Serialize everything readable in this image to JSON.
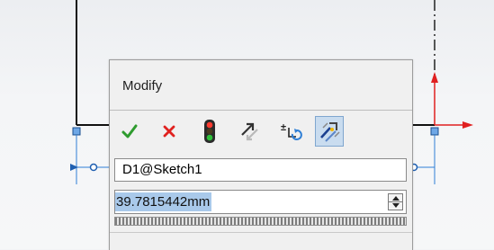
{
  "dialog": {
    "title": "Modify",
    "toolbar": [
      {
        "name": "ok-checkmark-icon",
        "tooltip": "OK"
      },
      {
        "name": "cancel-x-icon",
        "tooltip": "Cancel"
      },
      {
        "name": "rebuild-traffic-light-icon",
        "tooltip": "Rebuild"
      },
      {
        "name": "reverse-dimension-icon",
        "tooltip": "Reverse dimension"
      },
      {
        "name": "reset-spin-increment-icon",
        "tooltip": "Reset spin increment"
      },
      {
        "name": "mark-dimension-icon",
        "tooltip": "Mark dimension"
      }
    ],
    "dimension_name": "D1@Sketch1",
    "value": "39.7815442mm"
  },
  "colors": {
    "ok": "#2e9b2e",
    "cancel": "#e0211f",
    "selection": "#a9c9ea",
    "axis_red": "#e02020",
    "sketch_blue": "#2f7fd6"
  }
}
